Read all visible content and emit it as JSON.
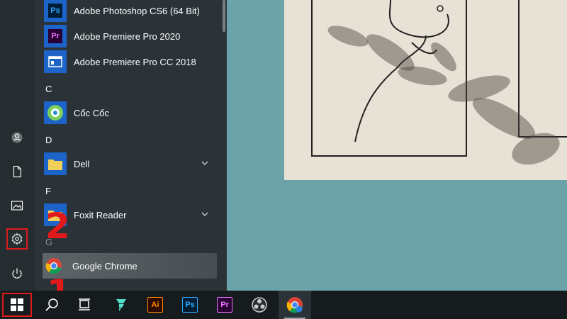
{
  "start_menu": {
    "apps": [
      {
        "label": "Adobe Photoshop CS6 (64 Bit)",
        "icon_text": "Ps",
        "icon": "photoshop-icon",
        "bg": "#1c64c8",
        "fg": "#ffffff"
      },
      {
        "label": "Adobe Premiere Pro 2020",
        "icon_text": "Pr",
        "icon": "premiere-icon",
        "bg": "#1c64c8",
        "fg": "#e0b3ff"
      },
      {
        "label": "Adobe Premiere Pro CC 2018",
        "icon_text": "",
        "icon": "window-icon",
        "bg": "#1c64c8",
        "fg": "#ffffff"
      },
      {
        "label": "Cốc Cốc",
        "icon_text": "",
        "icon": "coccoc-icon",
        "bg": "#1c64c8",
        "fg": "#ffffff"
      },
      {
        "label": "Dell",
        "icon_text": "",
        "icon": "folder-icon",
        "bg": "#1c64c8",
        "fg": "#ffffff"
      },
      {
        "label": "Foxit Reader",
        "icon_text": "",
        "icon": "folder-icon",
        "bg": "#1c64c8",
        "fg": "#ffffff"
      },
      {
        "label": "Google Chrome",
        "icon_text": "",
        "icon": "chrome-icon",
        "bg": "transparent",
        "fg": "#ffffff"
      }
    ],
    "letters": {
      "c": "C",
      "d": "D",
      "f": "F",
      "g": "G"
    },
    "rail": [
      "user-icon",
      "document-icon",
      "pictures-icon",
      "settings-icon",
      "power-icon"
    ]
  },
  "annotations": {
    "step1": "1",
    "step2": "2"
  },
  "taskbar": {
    "apps": [
      {
        "name": "filmora",
        "text": ""
      },
      {
        "name": "illustrator",
        "text": "Ai",
        "fg": "#ff8a00",
        "bg": "#2d0b00"
      },
      {
        "name": "photoshop",
        "text": "Ps",
        "fg": "#31a8ff",
        "bg": "#001e36"
      },
      {
        "name": "premiere",
        "text": "Pr",
        "fg": "#ea77ff",
        "bg": "#2a0034"
      },
      {
        "name": "obs",
        "text": ""
      },
      {
        "name": "chrome-quick",
        "text": ""
      }
    ]
  },
  "colors": {
    "accent_red": "#e01a1a",
    "tile_blue": "#1c64c8",
    "menu_bg": "#2b3338",
    "taskbar_bg": "#161b1e",
    "desktop": "#6ba3a8"
  }
}
